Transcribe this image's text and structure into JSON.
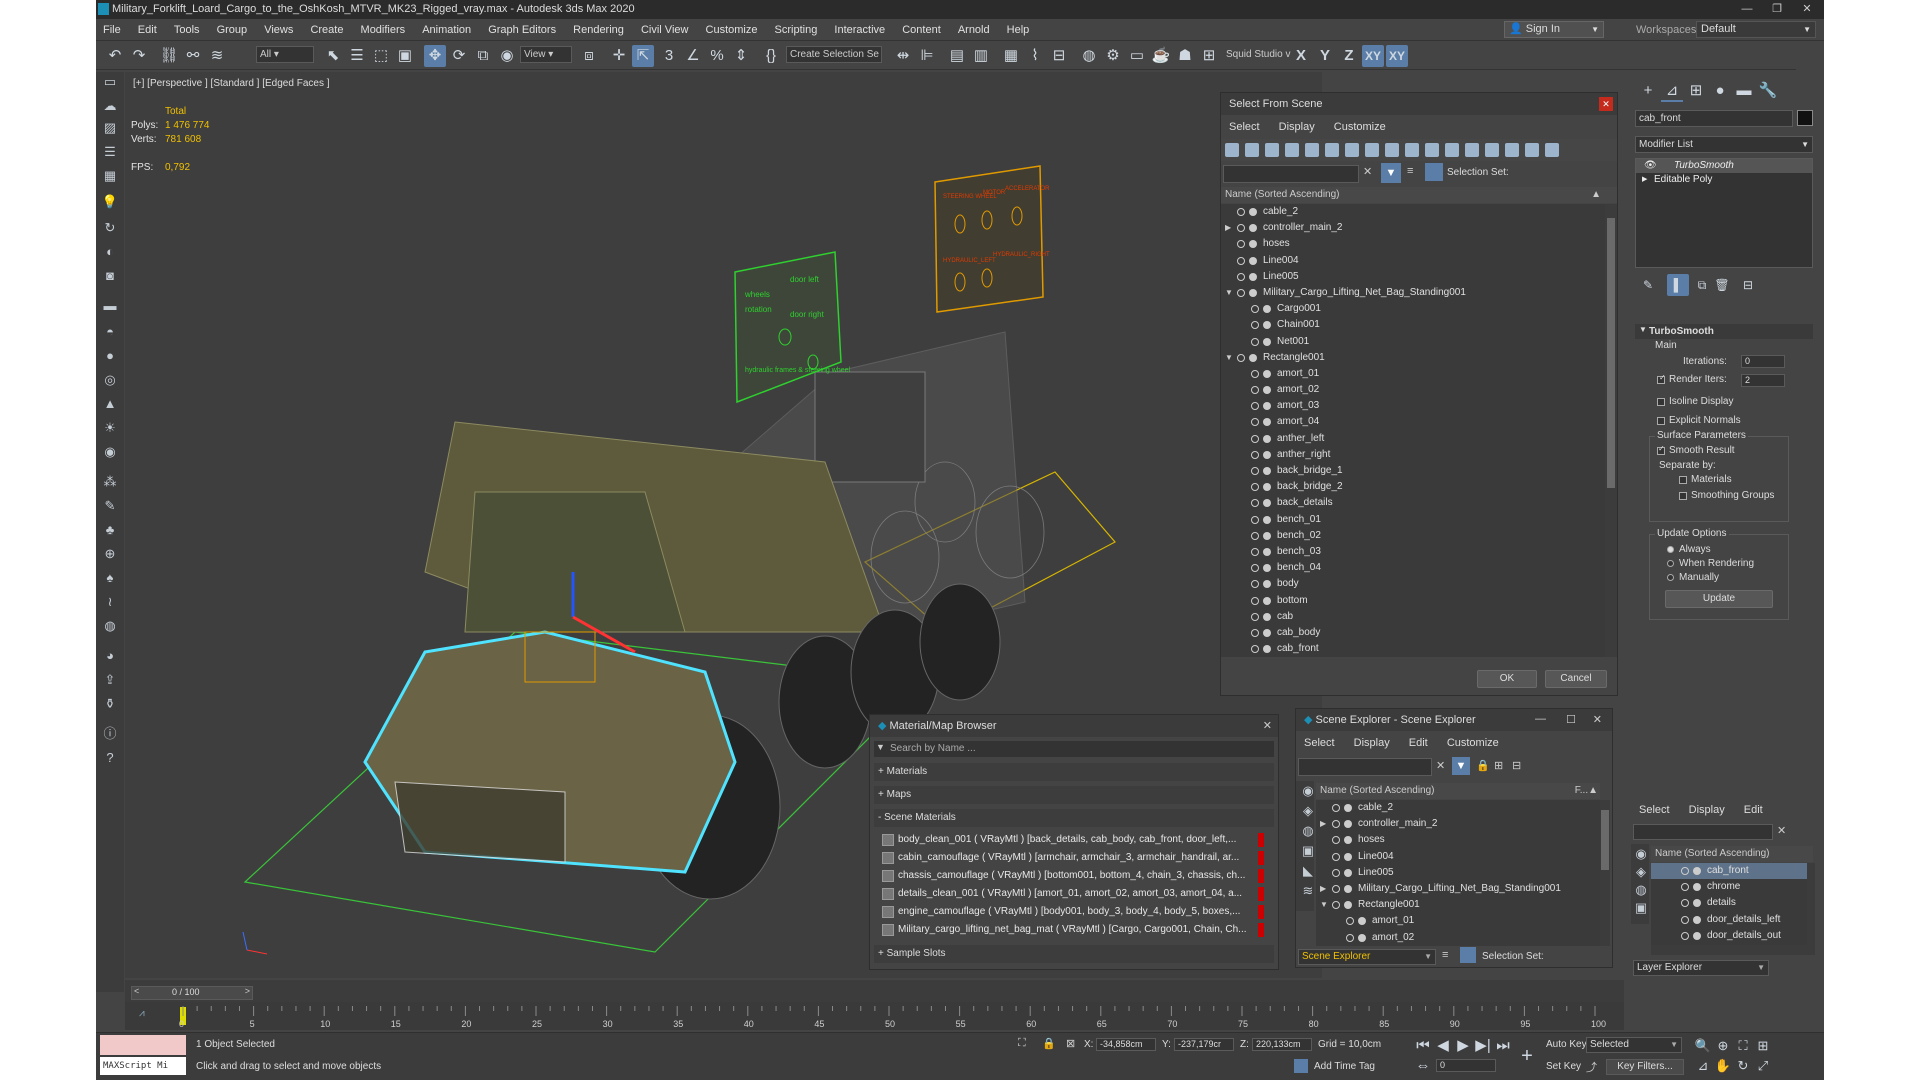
{
  "window": {
    "title": "Military_Forklift_Loard_Cargo_to_the_OshKosh_MTVR_MK23_Rigged_vray.max - Autodesk 3ds Max 2020"
  },
  "menu": [
    "File",
    "Edit",
    "Tools",
    "Group",
    "Views",
    "Create",
    "Modifiers",
    "Animation",
    "Graph Editors",
    "Rendering",
    "Civil View",
    "Customize",
    "Scripting",
    "Interactive",
    "Content",
    "Arnold",
    "Help"
  ],
  "account": {
    "sign_in": "Sign In",
    "workspaces_label": "Workspaces:",
    "workspace": "Default"
  },
  "toolbar": {
    "filter": "All",
    "ref_coord": "View",
    "create_selection": "Create Selection Se",
    "squid": "Squid Studio v",
    "axes": [
      "X",
      "Y",
      "Z",
      "XY",
      "XY"
    ]
  },
  "viewport": {
    "label": "[+] [Perspective ] [Standard ] [Edged Faces ]",
    "stats": {
      "total_label": "Total",
      "polys_label": "Polys:",
      "polys": "1 476 774",
      "verts_label": "Verts:",
      "verts": "781 608",
      "fps_label": "FPS:",
      "fps": "0,792"
    }
  },
  "select_from_scene": {
    "title": "Select From Scene",
    "menu": [
      "Select",
      "Display",
      "Customize"
    ],
    "selection_set_label": "Selection Set:",
    "column": "Name (Sorted Ascending)",
    "items": [
      {
        "label": "cable_2",
        "level": 0,
        "expand": ""
      },
      {
        "label": "controller_main_2",
        "level": 0,
        "expand": "▶"
      },
      {
        "label": "hoses",
        "level": 0,
        "expand": ""
      },
      {
        "label": "Line004",
        "level": 0,
        "expand": ""
      },
      {
        "label": "Line005",
        "level": 0,
        "expand": ""
      },
      {
        "label": "Military_Cargo_Lifting_Net_Bag_Standing001",
        "level": 0,
        "expand": "▼"
      },
      {
        "label": "Cargo001",
        "level": 1,
        "expand": ""
      },
      {
        "label": "Chain001",
        "level": 1,
        "expand": ""
      },
      {
        "label": "Net001",
        "level": 1,
        "expand": ""
      },
      {
        "label": "Rectangle001",
        "level": 0,
        "expand": "▼"
      },
      {
        "label": "amort_01",
        "level": 1,
        "expand": ""
      },
      {
        "label": "amort_02",
        "level": 1,
        "expand": ""
      },
      {
        "label": "amort_03",
        "level": 1,
        "expand": ""
      },
      {
        "label": "amort_04",
        "level": 1,
        "expand": ""
      },
      {
        "label": "anther_left",
        "level": 1,
        "expand": ""
      },
      {
        "label": "anther_right",
        "level": 1,
        "expand": ""
      },
      {
        "label": "back_bridge_1",
        "level": 1,
        "expand": ""
      },
      {
        "label": "back_bridge_2",
        "level": 1,
        "expand": ""
      },
      {
        "label": "back_details",
        "level": 1,
        "expand": ""
      },
      {
        "label": "bench_01",
        "level": 1,
        "expand": ""
      },
      {
        "label": "bench_02",
        "level": 1,
        "expand": ""
      },
      {
        "label": "bench_03",
        "level": 1,
        "expand": ""
      },
      {
        "label": "bench_04",
        "level": 1,
        "expand": ""
      },
      {
        "label": "body",
        "level": 1,
        "expand": ""
      },
      {
        "label": "bottom",
        "level": 1,
        "expand": ""
      },
      {
        "label": "cab",
        "level": 1,
        "expand": ""
      },
      {
        "label": "cab_body",
        "level": 1,
        "expand": ""
      },
      {
        "label": "cab_front",
        "level": 1,
        "expand": ""
      }
    ],
    "ok": "OK",
    "cancel": "Cancel"
  },
  "material_browser": {
    "title": "Material/Map Browser",
    "search_placeholder": "Search by Name ...",
    "sections": [
      "+ Materials",
      "+ Maps",
      "- Scene Materials",
      "+ Sample Slots"
    ],
    "materials": [
      "body_clean_001 ( VRayMtl ) [back_details, cab_body, cab_front, door_left,...",
      "cabin_camouflage ( VRayMtl ) [armchair, armchair_3, armchair_handrail, ar...",
      "chassis_camouflage ( VRayMtl ) [bottom001, bottom_4, chain_3, chassis, ch...",
      "details_clean_001 ( VRayMtl ) [amort_01, amort_02, amort_03, amort_04, a...",
      "engine_camouflage ( VRayMtl ) [body001, body_3, body_4, body_5, boxes,...",
      "Military_cargo_lifting_net_bag_mat ( VRayMtl ) [Cargo, Cargo001, Chain, Ch..."
    ]
  },
  "scene_explorer": {
    "title": "Scene Explorer - Scene Explorer",
    "menu": [
      "Select",
      "Display",
      "Edit",
      "Customize"
    ],
    "column": "Name (Sorted Ascending)",
    "column2": "F...▲",
    "items": [
      {
        "label": "cable_2",
        "level": 0,
        "expand": ""
      },
      {
        "label": "controller_main_2",
        "level": 0,
        "expand": "▶"
      },
      {
        "label": "hoses",
        "level": 0,
        "expand": ""
      },
      {
        "label": "Line004",
        "level": 0,
        "expand": ""
      },
      {
        "label": "Line005",
        "level": 0,
        "expand": ""
      },
      {
        "label": "Military_Cargo_Lifting_Net_Bag_Standing001",
        "level": 0,
        "expand": "▶"
      },
      {
        "label": "Rectangle001",
        "level": 0,
        "expand": "▼"
      },
      {
        "label": "amort_01",
        "level": 1,
        "expand": ""
      },
      {
        "label": "amort_02",
        "level": 1,
        "expand": ""
      }
    ],
    "footer_label": "Scene Explorer",
    "selection_set_label": "Selection Set:"
  },
  "command_panel": {
    "object_name": "cab_front",
    "modifier_list": "Modifier List",
    "stack": [
      "TurboSmooth",
      "Editable Poly"
    ],
    "turbosmooth": {
      "title": "TurboSmooth",
      "main": "Main",
      "iterations_label": "Iterations:",
      "iterations": "0",
      "render_iters_label": "Render Iters:",
      "render_iters": "2",
      "render_iters_checked": true,
      "isoline": "Isoline Display",
      "explicit_normals": "Explicit Normals",
      "surface_params": "Surface Parameters",
      "smooth_result": "Smooth Result",
      "separate_by": "Separate by:",
      "materials": "Materials",
      "smoothing_groups": "Smoothing Groups",
      "update_options": "Update Options",
      "always": "Always",
      "when_rendering": "When Rendering",
      "manually": "Manually",
      "update": "Update"
    }
  },
  "layer_explorer": {
    "menu": [
      "Select",
      "Display",
      "Edit"
    ],
    "column": "Name (Sorted Ascending)",
    "items": [
      "cab_front",
      "chrome",
      "details",
      "door_details_left",
      "door_details_out"
    ],
    "footer": "Layer Explorer"
  },
  "timeline": {
    "frame": "0 / 100",
    "ticks": [
      "0",
      "5",
      "10",
      "15",
      "20",
      "25",
      "30",
      "35",
      "40",
      "45",
      "50",
      "55",
      "60",
      "65",
      "70",
      "75",
      "80",
      "85",
      "90",
      "95",
      "100"
    ]
  },
  "status": {
    "maxscript": "MAXScript Mi",
    "selected": "1 Object Selected",
    "prompt": "Click and drag to select and move objects",
    "x_label": "X:",
    "x": "-34,858cm",
    "y_label": "Y:",
    "y": "-237,179cr",
    "z_label": "Z:",
    "z": "220,133cm",
    "grid": "Grid = 10,0cm",
    "add_time_tag": "Add Time Tag",
    "auto_key": "Auto Key",
    "set_key": "Set Key",
    "selected_dd": "Selected",
    "key_filters": "Key Filters...",
    "frame_value": "0"
  },
  "panels": {
    "green_panel": [
      "wheels",
      "rotation",
      "door left",
      "door right",
      "hydraulic frames & steering wheel"
    ],
    "orange_panel": [
      "STEERING WHEEL",
      "MOTOR",
      "ACCELERATOR",
      "HYDRAULIC_LEFT",
      "HYDRAULIC_RIGHT"
    ]
  },
  "colors": {
    "accent_blue": "#5a7ea8",
    "stat_yellow": "#f0c000",
    "selection_cyan": "#4fe3ff",
    "helper_green": "#2fd02f",
    "helper_orange": "#e09a00"
  }
}
